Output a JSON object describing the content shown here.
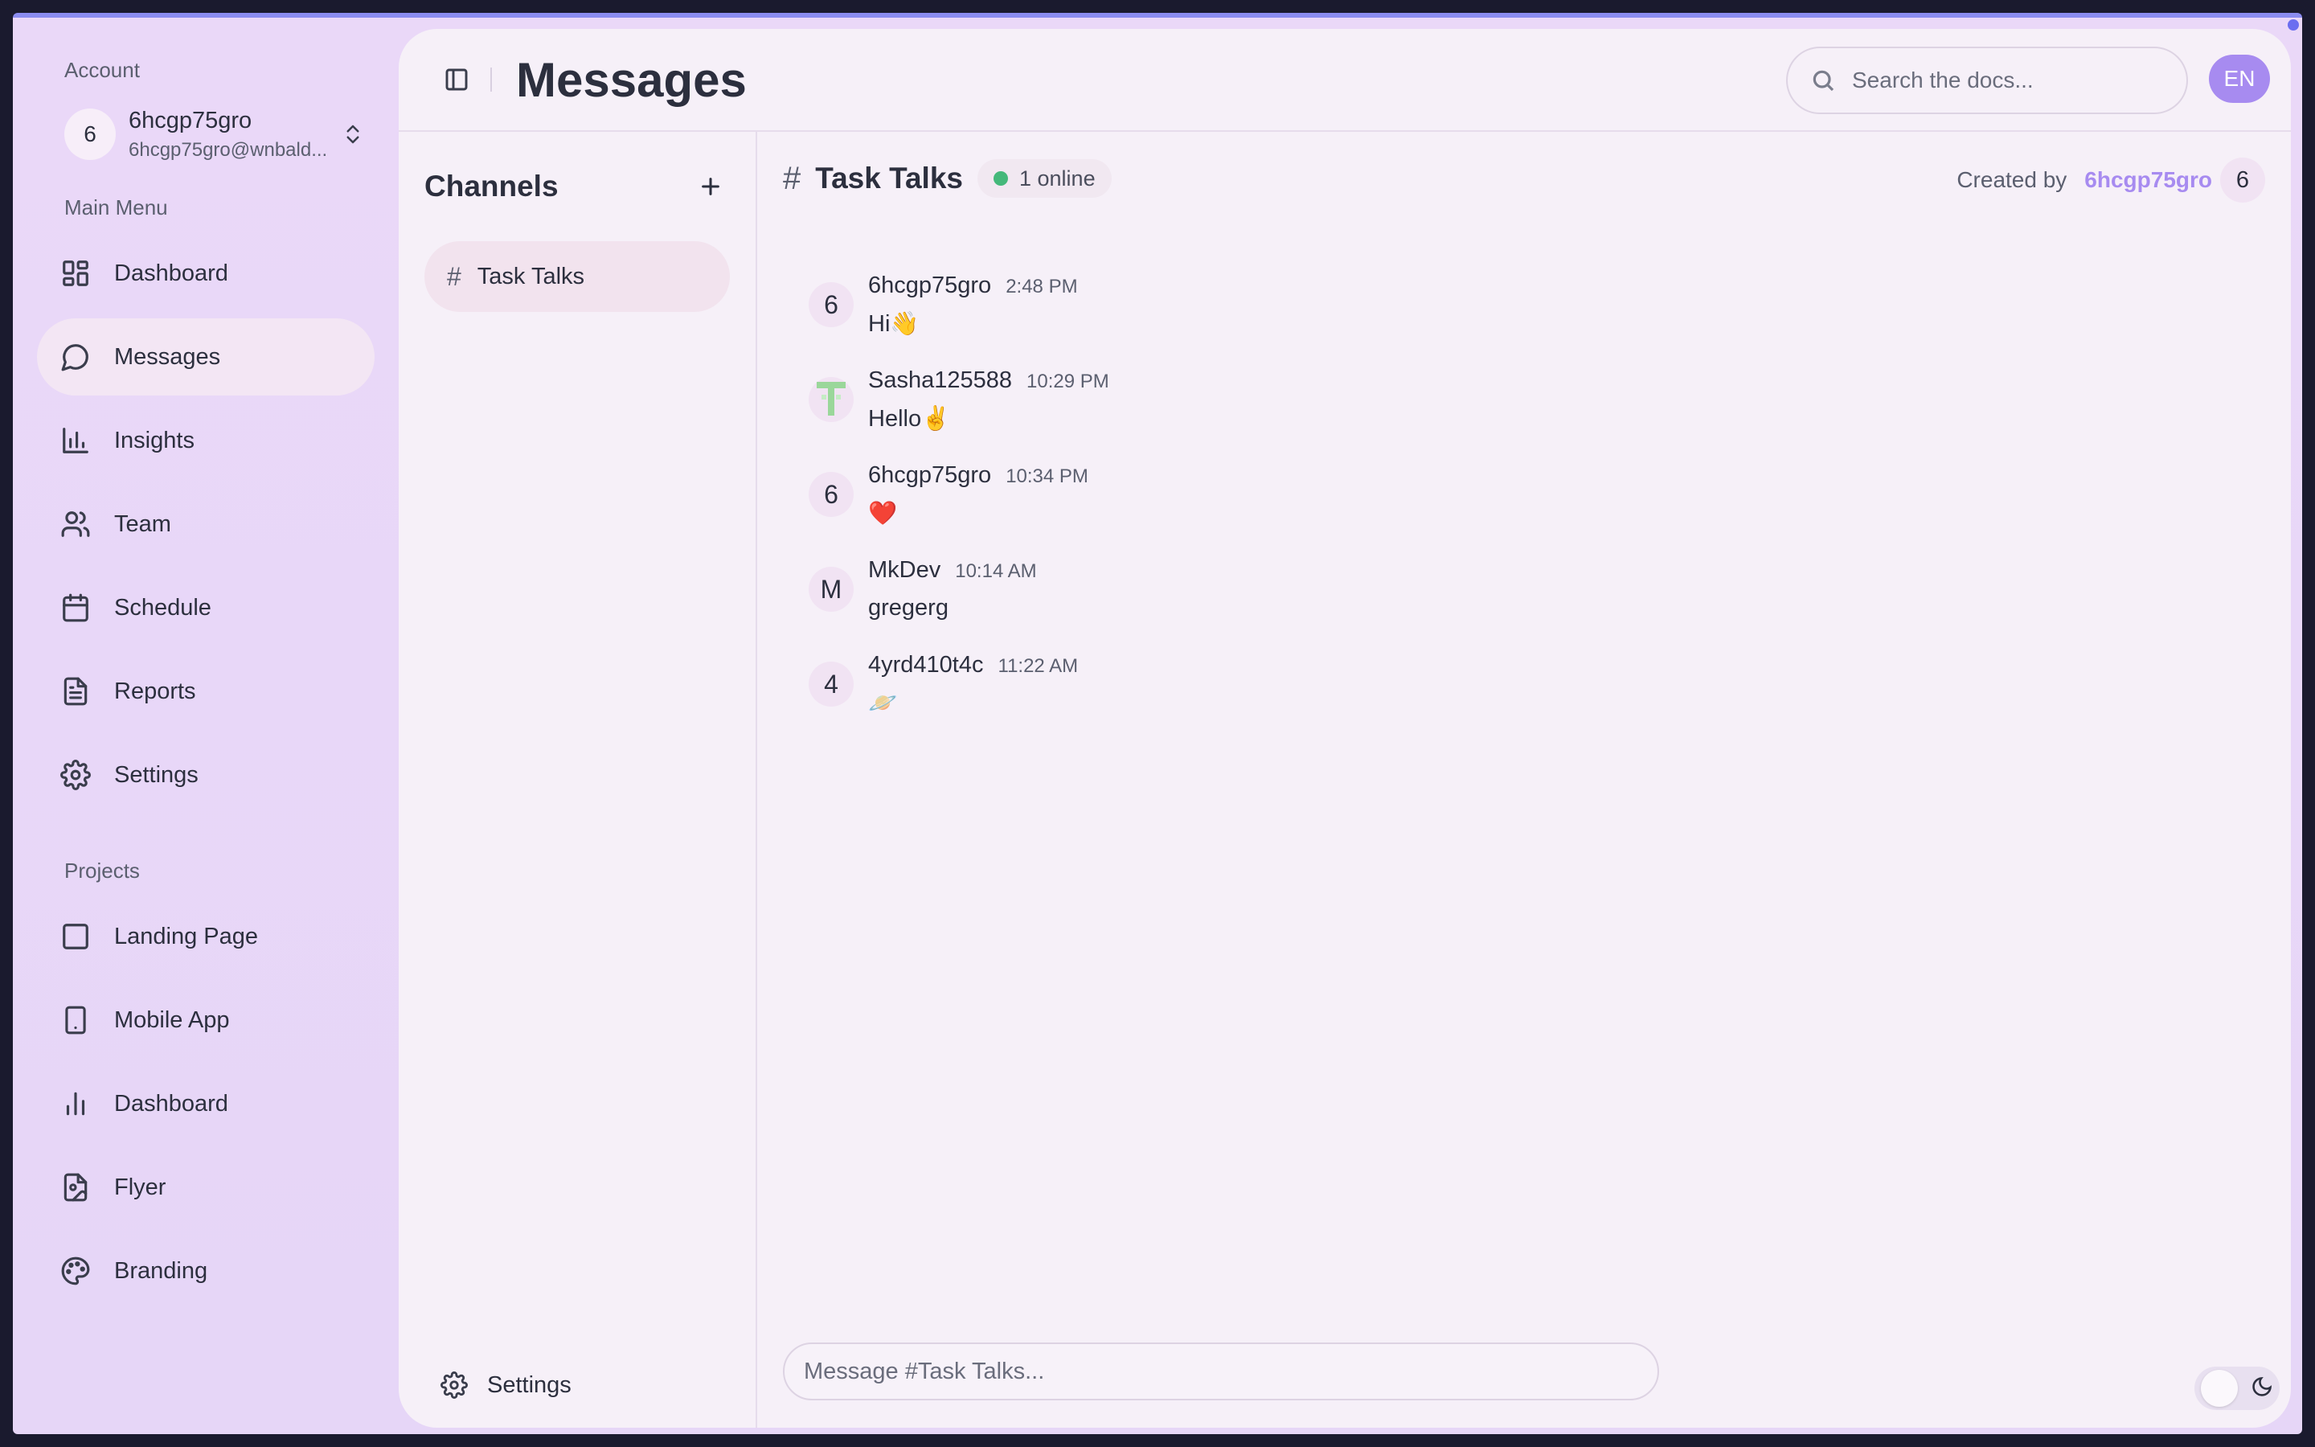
{
  "account": {
    "section_label": "Account",
    "avatar_letter": "6",
    "name": "6hcgp75gro",
    "email": "6hcgp75gro@wnbald..."
  },
  "main_menu": {
    "label": "Main Menu",
    "items": [
      {
        "label": "Dashboard",
        "icon": "dashboard-icon"
      },
      {
        "label": "Messages",
        "icon": "message-icon",
        "active": true
      },
      {
        "label": "Insights",
        "icon": "bar-chart-icon"
      },
      {
        "label": "Team",
        "icon": "users-icon"
      },
      {
        "label": "Schedule",
        "icon": "calendar-icon"
      },
      {
        "label": "Reports",
        "icon": "file-text-icon"
      },
      {
        "label": "Settings",
        "icon": "gear-icon"
      }
    ]
  },
  "projects": {
    "label": "Projects",
    "items": [
      {
        "label": "Landing Page",
        "icon": "square-icon"
      },
      {
        "label": "Mobile App",
        "icon": "phone-icon"
      },
      {
        "label": "Dashboard",
        "icon": "bar-chart-icon"
      },
      {
        "label": "Flyer",
        "icon": "file-image-icon"
      },
      {
        "label": "Branding",
        "icon": "palette-icon"
      }
    ]
  },
  "header": {
    "title": "Messages",
    "search_placeholder": "Search the docs...",
    "language": "EN"
  },
  "channels": {
    "title": "Channels",
    "items": [
      {
        "label": "Task Talks",
        "active": true
      }
    ],
    "settings_label": "Settings"
  },
  "chat": {
    "channel_name": "Task Talks",
    "online": "1 online",
    "created_by_label": "Created by",
    "creator": "6hcgp75gro",
    "creator_avatar": "6",
    "messages": [
      {
        "avatar": "6",
        "user": "6hcgp75gro",
        "time": "2:48 PM",
        "text": "Hi👋"
      },
      {
        "avatar": "",
        "user": "Sasha125588",
        "time": "10:29 PM",
        "text": "Hello✌️"
      },
      {
        "avatar": "6",
        "user": "6hcgp75gro",
        "time": "10:34 PM",
        "text": "❤️"
      },
      {
        "avatar": "M",
        "user": "MkDev",
        "time": "10:14 AM",
        "text": "gregerg"
      },
      {
        "avatar": "4",
        "user": "4yrd410t4c",
        "time": "11:22 AM",
        "text": "🪐"
      }
    ],
    "composer_placeholder": "Message #Task Talks..."
  },
  "colors": {
    "accent": "#a78bf0",
    "online": "#44b87a",
    "sidebar_bg": "#e8d8f7",
    "panel_bg": "#f6f0f8"
  }
}
